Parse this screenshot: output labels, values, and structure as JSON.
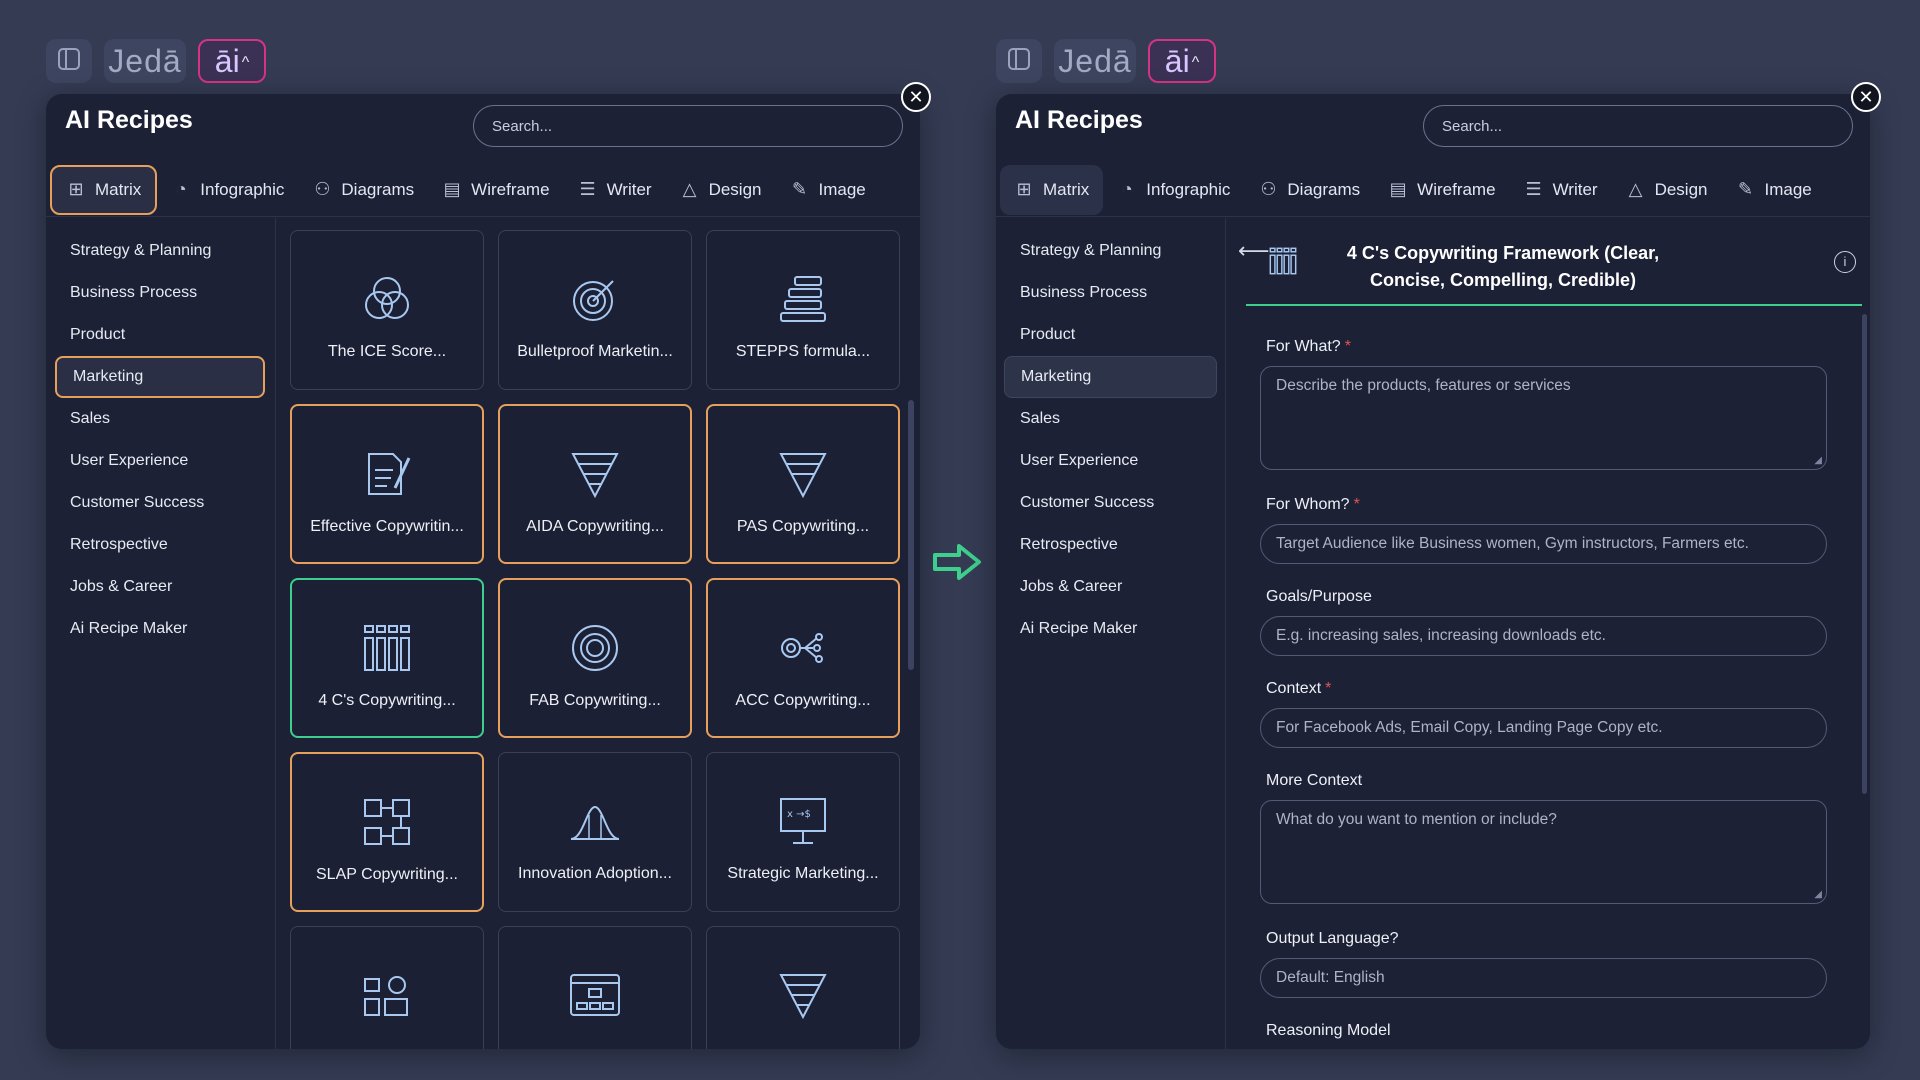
{
  "colors": {
    "background": "#343b53",
    "panel": "#1c2136",
    "orange_accent": "#e7a05c",
    "green_accent": "#3ecf8e",
    "brand_pink": "#d63384"
  },
  "topbar": {
    "logo_text": "Jedā",
    "ai_label": "āi",
    "ai_chevron": "^"
  },
  "panel_title": "AI Recipes",
  "search_placeholder": "Search...",
  "close_symbol": "✕",
  "tabs": [
    {
      "label": "Matrix",
      "icon": "matrix-icon"
    },
    {
      "label": "Infographic",
      "icon": "infographic-icon"
    },
    {
      "label": "Diagrams",
      "icon": "diagrams-icon"
    },
    {
      "label": "Wireframe",
      "icon": "wireframe-icon"
    },
    {
      "label": "Writer",
      "icon": "writer-icon"
    },
    {
      "label": "Design",
      "icon": "design-icon"
    },
    {
      "label": "Image",
      "icon": "image-icon"
    }
  ],
  "categories": [
    "Strategy & Planning",
    "Business Process",
    "Product",
    "Marketing",
    "Sales",
    "User Experience",
    "Customer Success",
    "Retrospective",
    "Jobs & Career",
    "Ai Recipe Maker"
  ],
  "selected_category": "Marketing",
  "cards": [
    {
      "label": "The ICE Score...",
      "icon": "venn-icon"
    },
    {
      "label": "Bulletproof Marketin...",
      "icon": "target-icon"
    },
    {
      "label": "STEPPS formula...",
      "icon": "stack-icon"
    },
    {
      "label": "Effective Copywritin...",
      "icon": "document-pen-icon"
    },
    {
      "label": "AIDA Copywriting...",
      "icon": "funnel-icon"
    },
    {
      "label": "PAS Copywriting...",
      "icon": "funnel-icon"
    },
    {
      "label": "4 C's Copywriting...",
      "icon": "columns-icon"
    },
    {
      "label": "FAB Copywriting...",
      "icon": "concentric-circles-icon"
    },
    {
      "label": "ACC Copywriting...",
      "icon": "network-icon"
    },
    {
      "label": "SLAP Copywriting...",
      "icon": "flow-boxes-icon"
    },
    {
      "label": "Innovation Adoption...",
      "icon": "bell-curve-icon"
    },
    {
      "label": "Strategic Marketing...",
      "icon": "presentation-board-icon"
    },
    {
      "label": "",
      "icon": "media-icon"
    },
    {
      "label": "",
      "icon": "sitemap-icon"
    },
    {
      "label": "",
      "icon": "funnel-icon"
    }
  ],
  "form": {
    "back_symbol": "⟵",
    "info_symbol": "i",
    "title": "4 C's Copywriting Framework (Clear, Concise, Compelling, Credible)",
    "fields": [
      {
        "label": "For What?",
        "required": true,
        "type": "multi",
        "placeholder": "Describe the products, features or services"
      },
      {
        "label": "For Whom?",
        "required": true,
        "type": "single",
        "placeholder": "Target Audience like Business women, Gym instructors, Farmers etc."
      },
      {
        "label": "Goals/Purpose",
        "required": false,
        "type": "single",
        "placeholder": "E.g. increasing sales, increasing downloads etc."
      },
      {
        "label": "Context",
        "required": true,
        "type": "single",
        "placeholder": "For Facebook Ads, Email Copy, Landing Page Copy etc."
      },
      {
        "label": "More Context",
        "required": false,
        "type": "multi",
        "placeholder": "What do you want to mention or include?"
      },
      {
        "label": "Output Language?",
        "required": false,
        "type": "single",
        "placeholder": "Default: English"
      },
      {
        "label": "Reasoning Model",
        "required": false,
        "type": "single",
        "placeholder": ""
      }
    ]
  }
}
